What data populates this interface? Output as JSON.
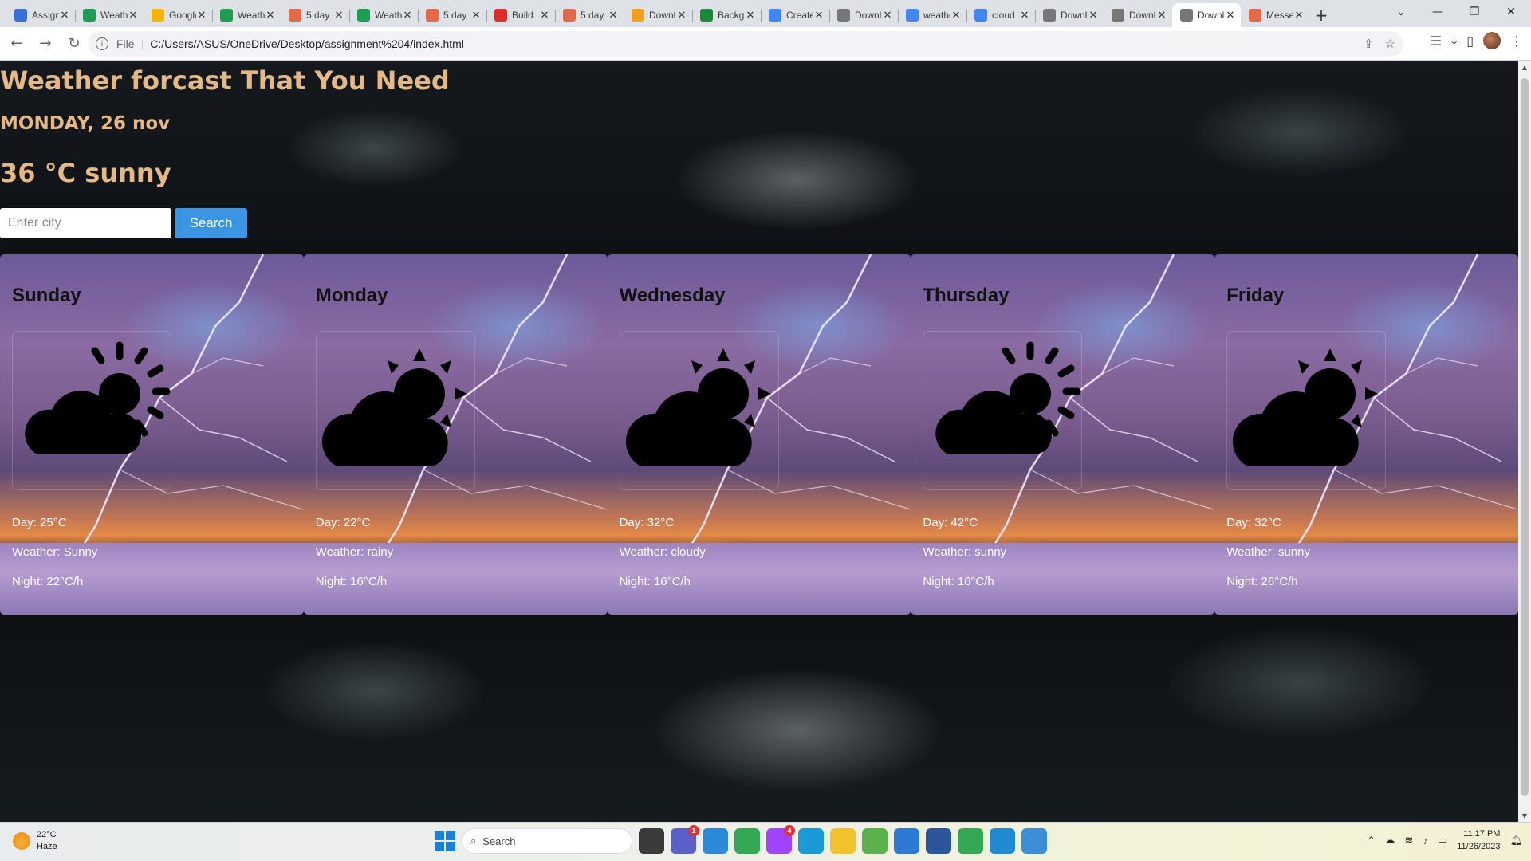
{
  "browser": {
    "tabs": [
      {
        "title": "Assignment",
        "color": "#3a6fd8",
        "active": false
      },
      {
        "title": "Weather",
        "color": "#1f9d55",
        "active": false
      },
      {
        "title": "Google",
        "color": "#f4b400",
        "active": false
      },
      {
        "title": "Weather",
        "color": "#1f9d55",
        "active": false
      },
      {
        "title": "5 day",
        "color": "#e2694a",
        "active": false
      },
      {
        "title": "Weather",
        "color": "#1f9d55",
        "active": false
      },
      {
        "title": "5 day",
        "color": "#e2694a",
        "active": false
      },
      {
        "title": "Build",
        "color": "#e02b2b",
        "active": false
      },
      {
        "title": "5 day",
        "color": "#e2694a",
        "active": false
      },
      {
        "title": "Download",
        "color": "#f0a020",
        "active": false
      },
      {
        "title": "Background",
        "color": "#1a8a3a",
        "active": false
      },
      {
        "title": "Create",
        "color": "#4285f4",
        "active": false
      },
      {
        "title": "Download",
        "color": "#777777",
        "active": false
      },
      {
        "title": "weather",
        "color": "#4285f4",
        "active": false
      },
      {
        "title": "cloud",
        "color": "#4285f4",
        "active": false
      },
      {
        "title": "Download",
        "color": "#777777",
        "active": false
      },
      {
        "title": "Download",
        "color": "#777777",
        "active": false
      },
      {
        "title": "Download",
        "color": "#777777",
        "active": true
      },
      {
        "title": "Messenger",
        "color": "#e2694a",
        "active": false
      }
    ],
    "address": {
      "scheme": "File",
      "url": "C:/Users/ASUS/OneDrive/Desktop/assignment%204/index.html"
    }
  },
  "page": {
    "title": "Weather forcast That You Need",
    "date": "MONDAY, 26 nov",
    "current": "36 °C sunny",
    "search": {
      "placeholder": "Enter city",
      "button": "Search"
    },
    "forecast": [
      {
        "day": "Sunday",
        "icon": "sun-behind-cloud-rays-icon",
        "day_temp": "Day: 25°C",
        "weather": "Weather: Sunny",
        "night": "Night: 22°C/h"
      },
      {
        "day": "Monday",
        "icon": "sun-behind-cloud-icon",
        "day_temp": "Day: 22°C",
        "weather": "Weather: rainy",
        "night": "Night: 16°C/h"
      },
      {
        "day": "Wednesday",
        "icon": "sun-behind-cloud-icon",
        "day_temp": "Day: 32°C",
        "weather": "Weather: cloudy",
        "night": "Night: 16°C/h"
      },
      {
        "day": "Thursday",
        "icon": "sun-behind-cloud-rays-icon",
        "day_temp": "Day: 42°C",
        "weather": "Weather: sunny",
        "night": "Night: 16°C/h"
      },
      {
        "day": "Friday",
        "icon": "sun-behind-cloud-icon",
        "day_temp": "Day: 32°C",
        "weather": "Weather: sunny",
        "night": "Night: 26°C/h"
      }
    ]
  },
  "taskbar": {
    "weather_temp": "22°C",
    "weather_desc": "Haze",
    "search_label": "Search",
    "time": "11:17 PM",
    "date": "11/26/2023",
    "apps": [
      {
        "name": "file-explorer-icon",
        "color": "#3a3a3a",
        "badge": ""
      },
      {
        "name": "teams-icon",
        "color": "#5b5fc7",
        "badge": "1"
      },
      {
        "name": "screen-icon",
        "color": "#2a8ad8",
        "badge": ""
      },
      {
        "name": "chrome-icon",
        "color": "#34a853",
        "badge": ""
      },
      {
        "name": "messenger-icon",
        "color": "#a044ff",
        "badge": "4"
      },
      {
        "name": "edge-icon",
        "color": "#1a9bd7",
        "badge": ""
      },
      {
        "name": "folder-icon",
        "color": "#f2c12e",
        "badge": ""
      },
      {
        "name": "utorrent-icon",
        "color": "#5db14c",
        "badge": ""
      },
      {
        "name": "paint-icon",
        "color": "#2d7ad6",
        "badge": ""
      },
      {
        "name": "word-icon",
        "color": "#2b579a",
        "badge": ""
      },
      {
        "name": "chrome-profile-icon",
        "color": "#34a853",
        "badge": ""
      },
      {
        "name": "vscode-icon",
        "color": "#1f8ad2",
        "badge": ""
      },
      {
        "name": "notepad-icon",
        "color": "#3a8fd8",
        "badge": ""
      }
    ]
  }
}
